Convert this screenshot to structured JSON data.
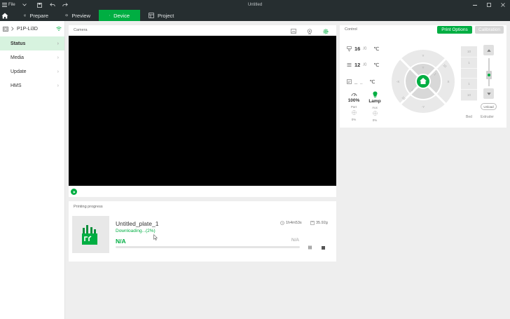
{
  "titlebar": {
    "menu_label": "File",
    "window_title": "Untitled",
    "icons": [
      "hamburger-icon",
      "chevron-down-icon",
      "save-icon",
      "undo-icon",
      "redo-icon",
      "minimize-icon",
      "maximize-icon",
      "close-icon"
    ]
  },
  "tabs": [
    {
      "label": "Prepare",
      "icon": "cube-icon"
    },
    {
      "label": "Preview",
      "icon": "layers-icon"
    },
    {
      "label": "Device",
      "icon": "device-icon",
      "active": true
    },
    {
      "label": "Project",
      "icon": "project-icon"
    }
  ],
  "sidebar": {
    "printer_name": "P1P-Li3D",
    "items": [
      {
        "label": "Status",
        "active": true
      },
      {
        "label": "Media"
      },
      {
        "label": "Update"
      },
      {
        "label": "HMS"
      }
    ]
  },
  "camera": {
    "title": "Camera"
  },
  "printing": {
    "title": "Printing progress",
    "job_name": "Untitled_plate_1",
    "status": "Downloading...(2%)",
    "time": "1h4m53s",
    "weight": "35.92g",
    "percent_label": "N/A",
    "layers_label": "N/A",
    "progress": 0
  },
  "control": {
    "title": "Control",
    "print_options_label": "Print Options",
    "calibration_label": "Calibration",
    "nozzle": {
      "current": "16",
      "target": "/0",
      "unit": "℃"
    },
    "bed": {
      "current": "12",
      "target": "/0",
      "unit": "℃"
    },
    "chamber": {
      "current": "_",
      "target": "_",
      "unit": "℃"
    },
    "part_fan": {
      "value": "100%",
      "label": "Part",
      "percent": "0%"
    },
    "lamp": {
      "value": "Lamp",
      "label": "Aux",
      "percent": "0%"
    },
    "jog_labels": {
      "y_plus": "Y",
      "x_minus": "-X",
      "x_plus": "X",
      "y_minus": "-Y",
      "ten_tr": "10",
      "one_tr": "1",
      "one_bl": "1",
      "ten_bl": "10"
    },
    "bed_axis": {
      "label": "Bed",
      "steps": [
        "10",
        "1",
        "1",
        "10"
      ]
    },
    "extruder": {
      "label": "Extruder",
      "unload_label": "Unload"
    }
  },
  "colors": {
    "accent": "#00ae42",
    "titlebar": "#262e30",
    "selected": "#d7f3df"
  }
}
